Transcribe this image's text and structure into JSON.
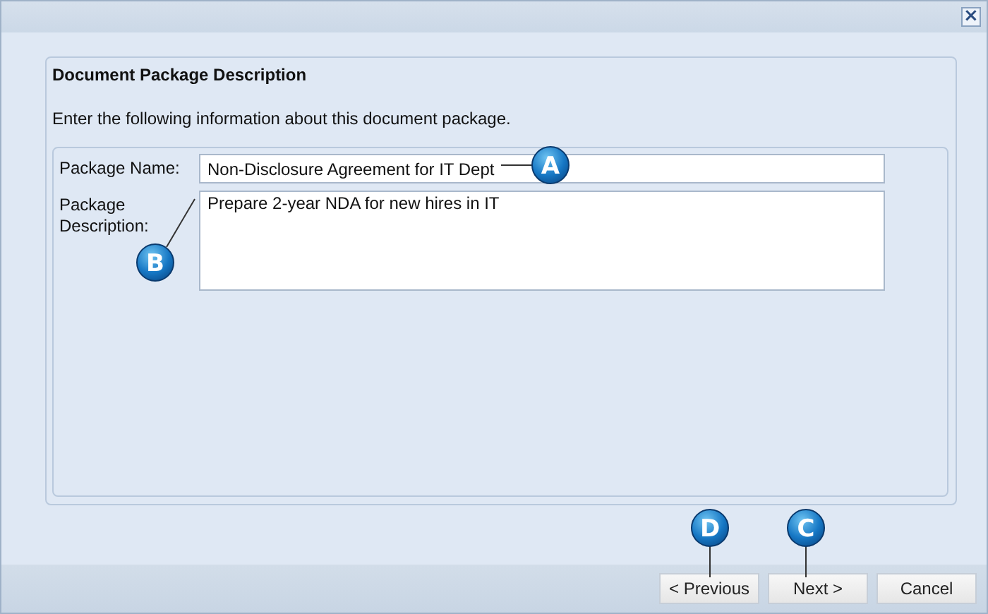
{
  "window": {
    "close_label": "×"
  },
  "section": {
    "title": "Document Package Description",
    "instructions": "Enter the following information about this document package."
  },
  "fields": [
    {
      "label": "Package Name:",
      "value": "Non-Disclosure Agreement for IT Dept",
      "kind": "line"
    },
    {
      "label": "Package Description:",
      "value": "Prepare 2-year NDA for new hires in IT",
      "kind": "area"
    }
  ],
  "callouts": [
    {
      "letter": "A"
    },
    {
      "letter": "B"
    },
    {
      "letter": "D"
    },
    {
      "letter": "C"
    }
  ],
  "buttons": [
    "< Previous",
    "Next >",
    "Cancel"
  ]
}
